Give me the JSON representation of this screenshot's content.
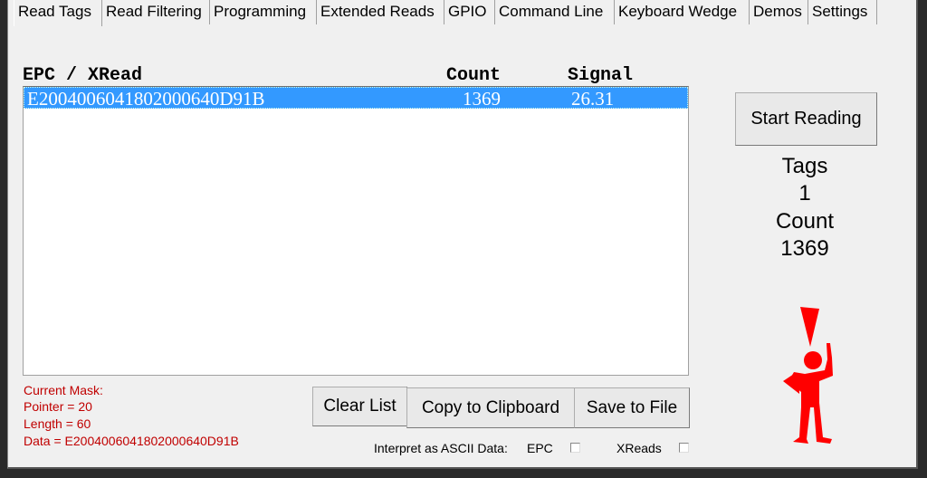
{
  "tabs": [
    "Read Tags",
    "Read Filtering",
    "Programming",
    "Extended Reads",
    "GPIO",
    "Command Line",
    "Keyboard Wedge",
    "Demos",
    "Settings"
  ],
  "list": {
    "headers": {
      "epc": "EPC / XRead",
      "count": "Count",
      "signal": "Signal"
    },
    "rows": [
      {
        "epc": "E2004006041802000640D91B",
        "count": "1369",
        "signal": "26.31",
        "selected": true
      }
    ]
  },
  "start_button": "Start Reading",
  "stats": {
    "tags_label": "Tags",
    "tags_value": "1",
    "count_label": "Count",
    "count_value": "1369"
  },
  "mask": {
    "title": "Current Mask:",
    "pointer": "Pointer = 20",
    "length": "Length = 60",
    "data": "Data = E2004006041802000640D91B"
  },
  "buttons": {
    "clear": "Clear List",
    "copy": "Copy to Clipboard",
    "save": "Save to File"
  },
  "ascii": {
    "label": "Interpret as ASCII Data:",
    "epc": "EPC",
    "epc_checked": false,
    "xreads": "XReads",
    "xreads_checked": false
  },
  "colors": {
    "selection": "#3399ff",
    "mask_text": "#c00000",
    "alert_icon": "#ff0000"
  },
  "icons": {
    "alert": "person-exclamation-icon"
  }
}
